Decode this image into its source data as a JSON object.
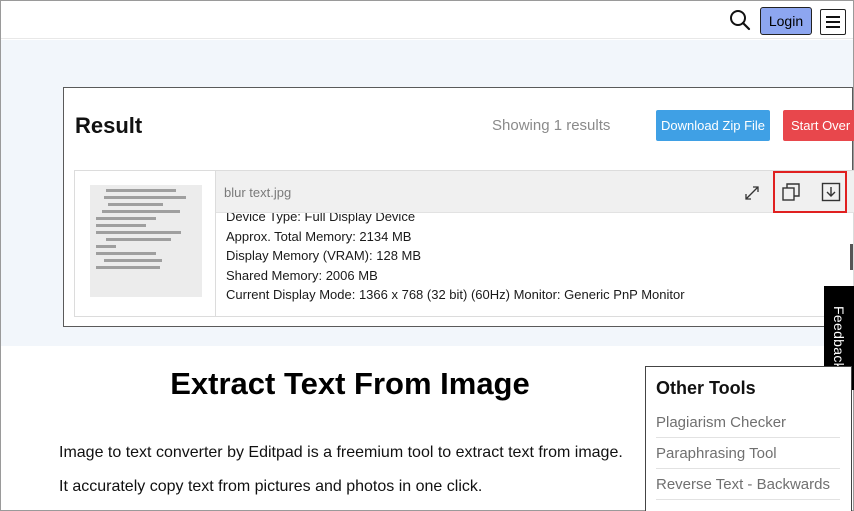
{
  "header": {
    "search_icon": "search-icon",
    "login_label": "Login",
    "menu_icon": "hamburger-menu-icon"
  },
  "result": {
    "title": "Result",
    "showing_text": "Showing 1 results",
    "download_zip_label": "Download Zip File",
    "start_over_label": "Start Over",
    "file": {
      "name": "blur text.jpg",
      "extracted_lines": [
        "Device Type: Full Display Device",
        "Approx. Total Memory: 2134 MB",
        "Display Memory (VRAM): 128 MB",
        "Shared Memory: 2006 MB",
        "Current Display Mode: 1366 x 768 (32 bit) (60Hz) Monitor: Generic PnP Monitor"
      ]
    }
  },
  "feedback_label": "Feedback",
  "main": {
    "title": "Extract Text From Image",
    "description": "Image to text converter by Editpad is a freemium tool to extract text from image. It accurately copy text from pictures and photos in one click."
  },
  "other_tools": {
    "title": "Other Tools",
    "items": [
      "Plagiarism Checker",
      "Paraphrasing Tool",
      "Reverse Text - Backwards"
    ]
  },
  "colors": {
    "login_bg": "#8da6f0",
    "zip_button": "#3fa0e5",
    "start_over_button": "#e8474c",
    "highlight_box": "#e02020",
    "band_bg": "#f2f6fb"
  }
}
